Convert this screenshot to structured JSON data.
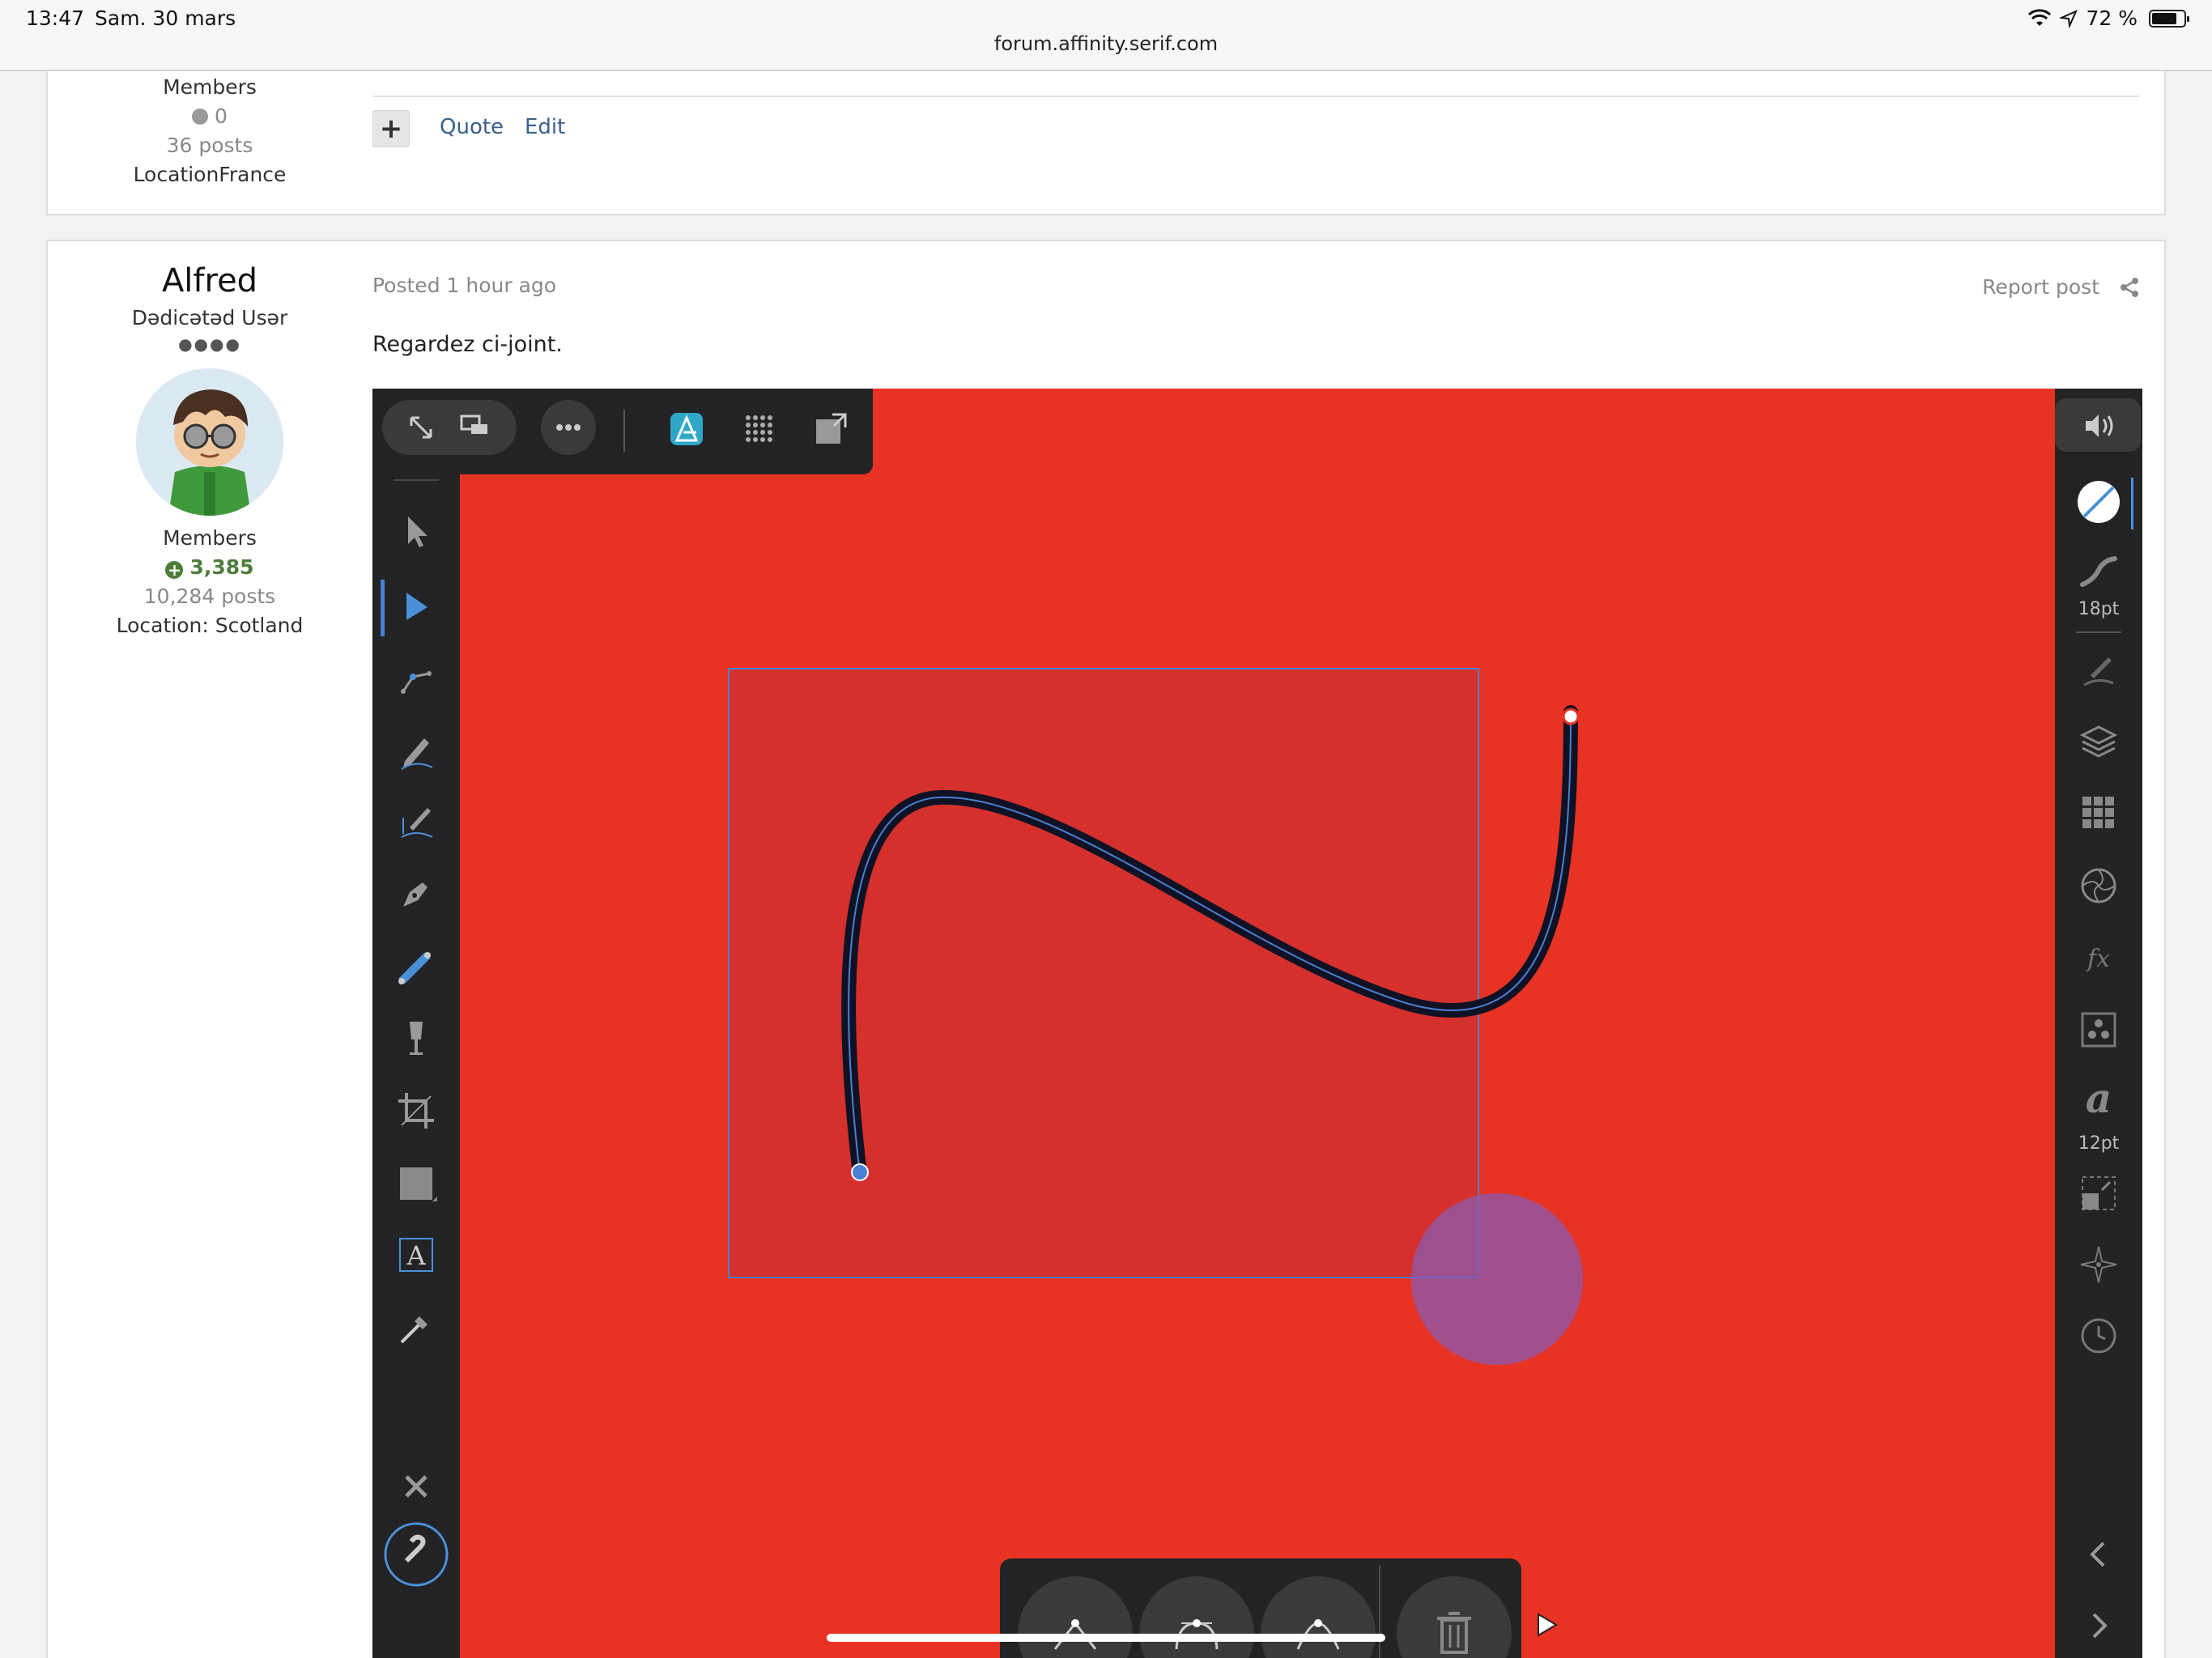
{
  "status_bar": {
    "time": "13:47",
    "date": "Sam. 30 mars",
    "url": "forum.affinity.serif.com",
    "battery": "72 %",
    "battery_level": 0.72
  },
  "post1": {
    "group": "Members",
    "reputation": "0",
    "posts": "36 posts",
    "location": "LocationFrance",
    "actions": {
      "quote": "Quote",
      "edit": "Edit"
    }
  },
  "post2": {
    "author": "Alfred",
    "user_title": "Dədicətəd Usər",
    "group": "Members",
    "reputation": "3,385",
    "posts": "10,284 posts",
    "location": "Location: Scotland",
    "posted": "Posted 1 hour ago",
    "report": "Report post",
    "body": "Regardez ci-joint."
  },
  "app": {
    "canvas_color": "#e83224",
    "stroke_size": "18pt",
    "font_size": "12pt",
    "font_glyph": "a",
    "text_tool_glyph": "A",
    "fx_label": "fx"
  },
  "colors": {
    "link": "#3a5f8a",
    "reputation_positive": "#4e7c3a",
    "toolbar": "#232325",
    "selection": "#4a7fd4"
  }
}
